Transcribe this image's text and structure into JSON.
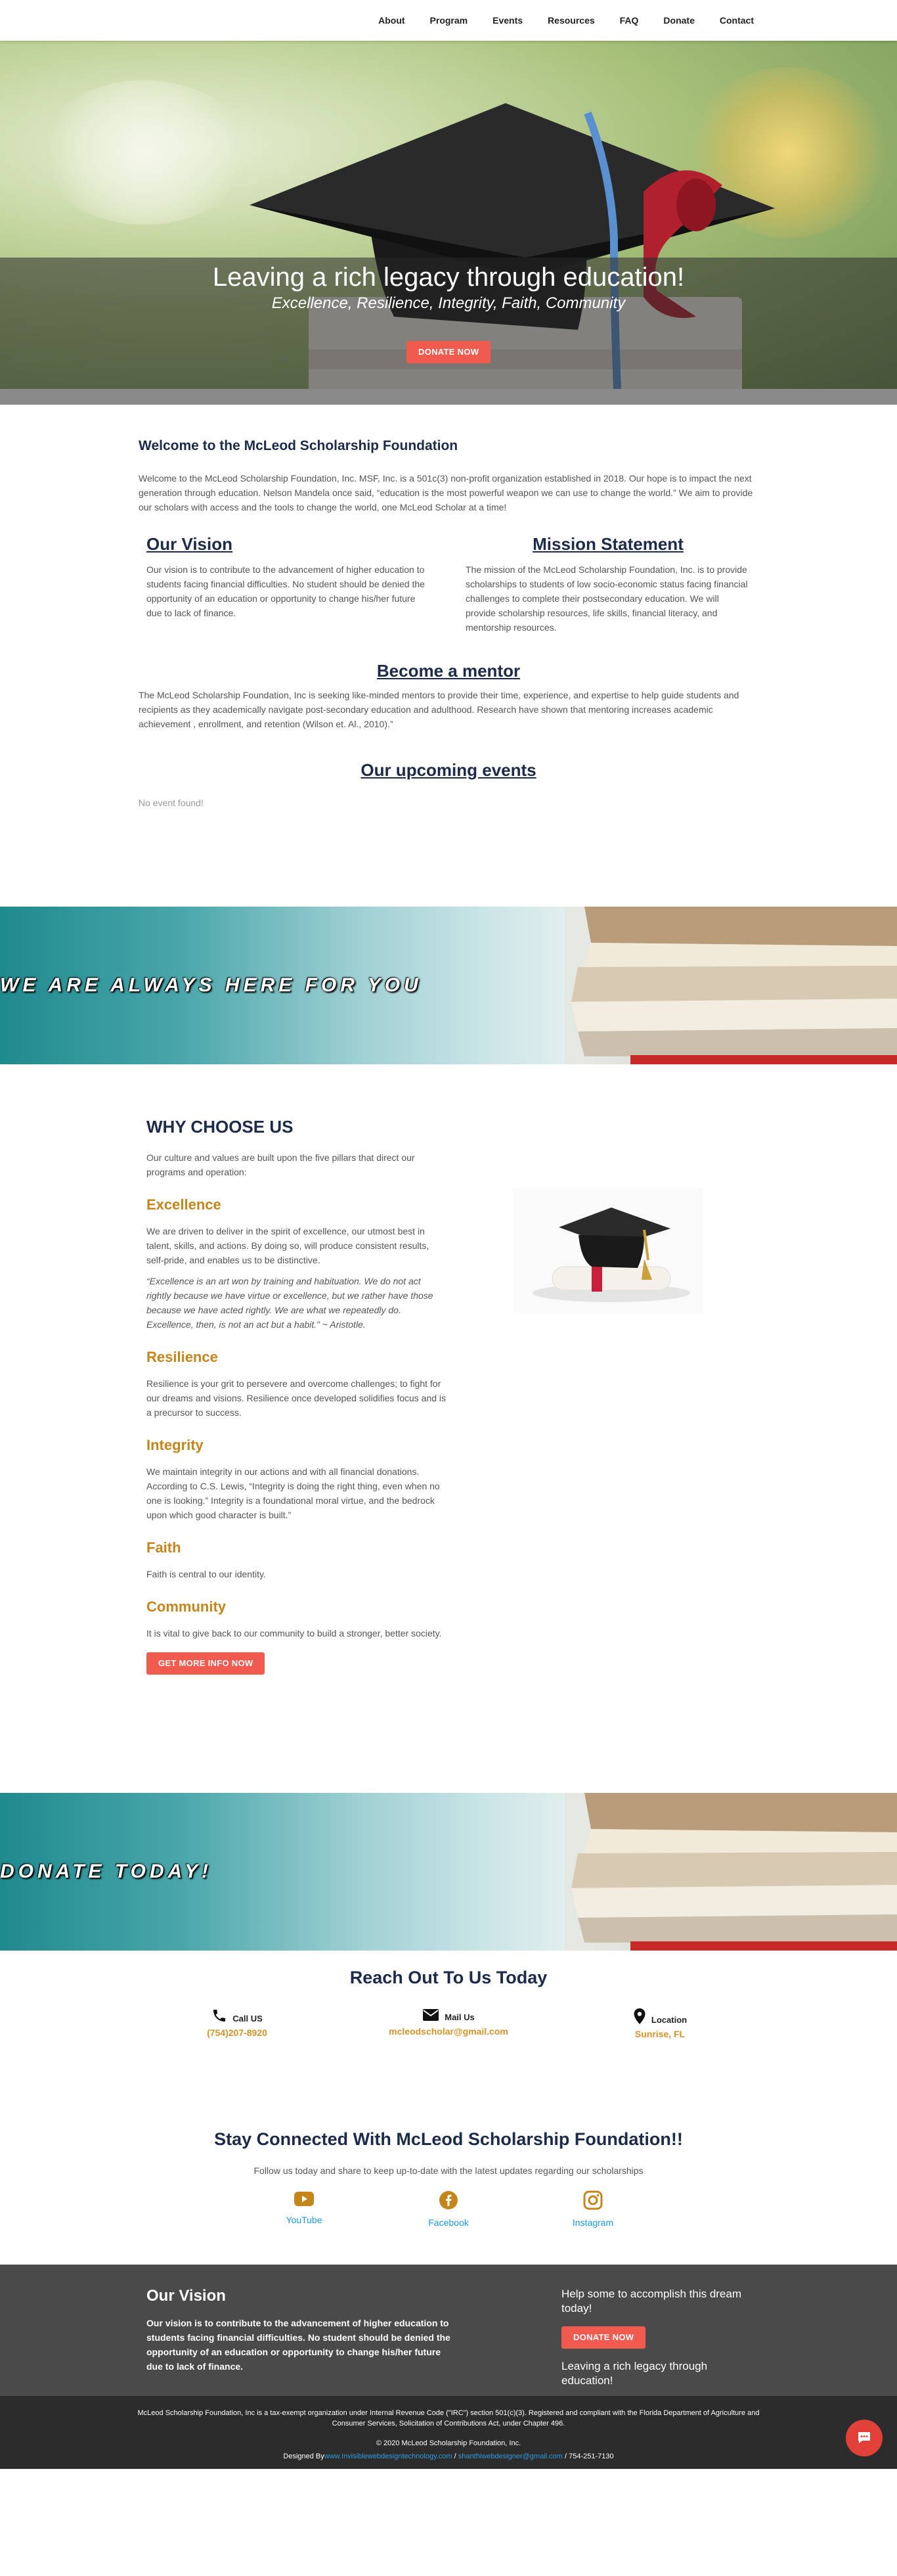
{
  "nav": {
    "items": [
      "About",
      "Program",
      "Events",
      "Resources",
      "FAQ",
      "Donate",
      "Contact"
    ]
  },
  "hero": {
    "title": "Leaving a rich legacy through education!",
    "subtitle": "Excellence, Resilience, Integrity, Faith, Community",
    "button": "DONATE NOW"
  },
  "welcome": {
    "title": "Welcome to the McLeod Scholarship Foundation",
    "text": "Welcome to the McLeod Scholarship Foundation, Inc. MSF, Inc. is a 501c(3) non-profit organization established in 2018. Our hope is to impact the next generation through education. Nelson Mandela once said, “education is the most powerful weapon we can use to change the world.” We aim to provide our scholars with access and the tools to change the world, one McLeod Scholar at a time!"
  },
  "vision": {
    "title": "Our Vision",
    "text": "Our vision is to contribute to the advancement of higher education to students facing financial difficulties. No student should be denied the opportunity of an education or opportunity to change his/her future due to lack of finance."
  },
  "mission": {
    "title": "Mission Statement",
    "text": "The mission of the McLeod Scholarship Foundation, Inc. is to provide scholarships to students of low socio-economic status facing financial challenges to complete their postsecondary education. We will provide scholarship resources, life skills, financial literacy, and mentorship resources."
  },
  "mentor": {
    "title": "Become a mentor",
    "text": "The McLeod Scholarship Foundation, Inc is seeking like-minded mentors to provide their time, experience, and expertise to help guide students and recipients as they academically navigate post-secondary education and adulthood. Research have shown that mentoring increases academic achievement , enrollment, and retention (Wilson et. Al., 2010).”"
  },
  "events": {
    "title": "Our upcoming events",
    "empty": "No event found!"
  },
  "banner1": {
    "text": "WE ARE ALWAYS HERE FOR YOU"
  },
  "why": {
    "title": "WHY CHOOSE US",
    "intro": "Our culture and values are built upon the five pillars that direct our programs and operation:",
    "pillars": [
      {
        "name": "Excellence",
        "text": "We are driven to deliver in the spirit of excellence, our utmost best in talent, skills, and actions. By doing so, will produce consistent results, self-pride, and enables us to be distinctive.",
        "quote": "“Excellence is an art won by training and habituation. We do not act rightly because we have virtue or excellence, but we rather have those because we have acted rightly. We are what we repeatedly do. Excellence, then, is not an act but a habit.” ~ Aristotle."
      },
      {
        "name": "Resilience",
        "text": "Resilience is your grit to persevere and overcome challenges; to fight for our dreams and visions. Resilience once developed solidifies focus and is a precursor to success."
      },
      {
        "name": "Integrity",
        "text": "We maintain integrity in our actions and with all financial donations. According to C.S. Lewis, “Integrity is doing the right thing, even when no one is looking.” Integrity is a foundational moral virtue, and the bedrock upon which good character is built.”"
      },
      {
        "name": "Faith",
        "text": "Faith is central to our identity."
      },
      {
        "name": "Community",
        "text": "It is vital to give back to our community to build a stronger, better society."
      }
    ],
    "button": "GET MORE INFO NOW"
  },
  "banner2": {
    "text": "DONATE TODAY!"
  },
  "contact": {
    "title": "Reach Out To Us Today",
    "items": [
      {
        "icon": "phone-icon",
        "label": "Call US",
        "value": "(754)207-8920"
      },
      {
        "icon": "mail-icon",
        "label": "Mail Us",
        "value": "mcleodscholar@gmail.com"
      },
      {
        "icon": "location-icon",
        "label": "Location",
        "value": "Sunrise, FL"
      }
    ]
  },
  "social": {
    "title": "Stay Connected With McLeod Scholarship Foundation!!",
    "subtitle": "Follow us today and share to keep up-to-date with the latest updates regarding our scholarships",
    "items": [
      {
        "icon": "youtube-icon",
        "label": "YouTube"
      },
      {
        "icon": "facebook-icon",
        "label": "Facebook"
      },
      {
        "icon": "instagram-icon",
        "label": "Instagram"
      }
    ]
  },
  "footer": {
    "title": "Our Vision",
    "text": "Our vision is to contribute to the advancement of higher education to students facing financial difficulties. No student should be denied the opportunity of an education or opportunity to change his/her future due to lack of finance.",
    "right_text": "Help some to accomplish this dream today!",
    "button": "DONATE NOW",
    "right_text2": "Leaving a rich legacy through education!"
  },
  "bottom": {
    "legal": "McLeod Scholarship Foundation, Inc is a tax-exempt organization under Internal Revenue Code (\"IRC\") section 501(c)(3). Registered and compliant with the Florida Department of Agriculture and Consumer Services, Solicitation of Contributions Act, under Chapter 496.",
    "copyright": "© 2020 McLeod Scholarship Foundation, Inc.",
    "designed_prefix": "Designed By",
    "designed_link1": "www.Invisiblewebdesigntechnology.com",
    "designed_sep": " / ",
    "designed_link2": "shanthiwebdesigner@gmail.com",
    "designed_phone": " / 754-251-7130"
  },
  "colors": {
    "accent_red": "#f05a4f",
    "pillar_gold": "#c4861a",
    "link_blue": "#1a9ad6",
    "heading_navy": "#1c2b4a"
  }
}
